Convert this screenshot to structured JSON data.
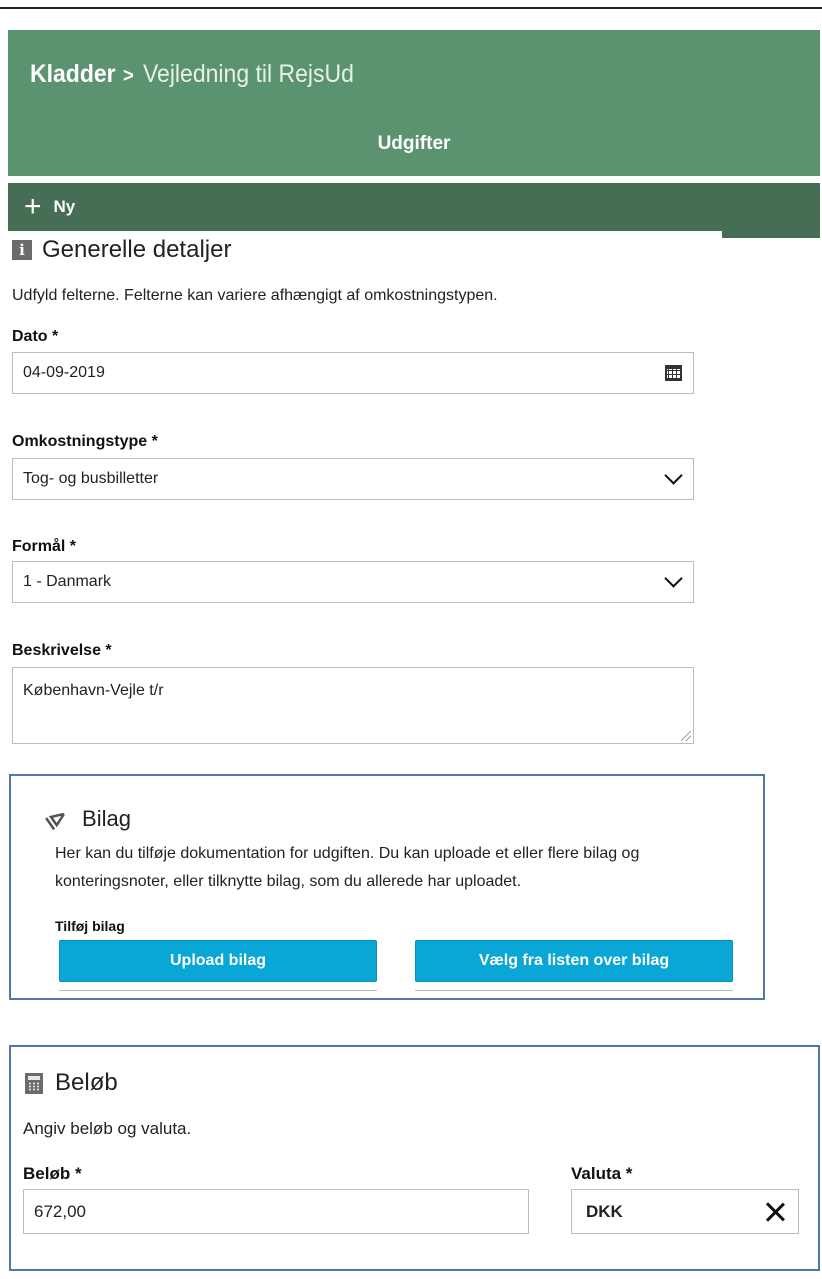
{
  "header": {
    "breadcrumb_root": "Kladder",
    "breadcrumb_sep": ">",
    "breadcrumb_current": "Vejledning til RejsUd",
    "subtitle": "Udgifter",
    "accent_color": "#5b9370",
    "toolbar_color": "#466e55"
  },
  "toolbar": {
    "new_icon": "plus-icon",
    "new_label": "Ny"
  },
  "general": {
    "icon": "info-icon",
    "icon_glyph": "i",
    "title": "Generelle detaljer",
    "hint": "Udfyld felterne. Felterne kan variere afhængigt af omkostningstypen.",
    "date": {
      "label": "Dato *",
      "value": "04-09-2019",
      "icon": "calendar-icon"
    },
    "expense_type": {
      "label": "Omkostningstype *",
      "value": "Tog- og busbilletter",
      "icon": "chevron-down-icon"
    },
    "purpose": {
      "label": "Formål *",
      "value": "1 - Danmark",
      "icon": "chevron-down-icon"
    },
    "description": {
      "label": "Beskrivelse *",
      "value": "København-Vejle t/r"
    }
  },
  "attachments": {
    "icon": "paperclip-icon",
    "title": "Bilag",
    "text": "Her kan du tilføje dokumentation for udgiften. Du kan uploade et eller flere bilag og konteringsnoter, eller tilknytte bilag, som du allerede har uploadet.",
    "add_label": "Tilføj bilag",
    "upload_button": "Upload bilag",
    "choose_button": "Vælg fra listen over bilag",
    "button_color": "#0aa7d6",
    "border_color": "#4f79a6"
  },
  "amount": {
    "icon": "calculator-icon",
    "title": "Beløb",
    "hint": "Angiv beløb og valuta.",
    "amount_label": "Beløb *",
    "amount_value": "672,00",
    "currency_label": "Valuta *",
    "currency_value": "DKK",
    "clear_icon": "close-icon"
  }
}
